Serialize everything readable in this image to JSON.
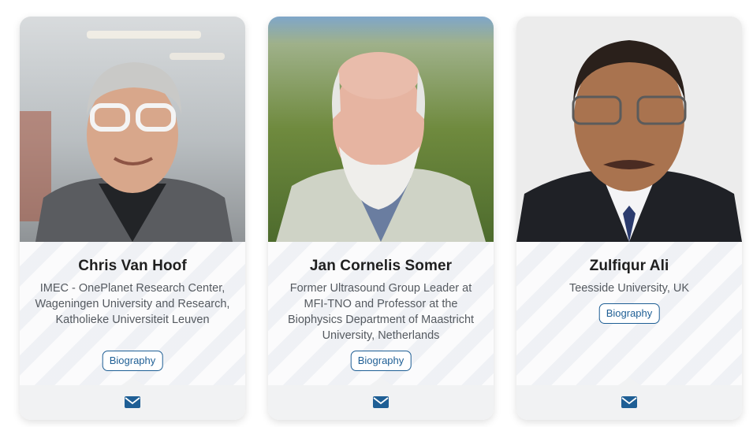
{
  "people": [
    {
      "name": "Chris Van Hoof",
      "affiliation": "IMEC - OnePlanet Research Center, Wageningen University and Research, Katholieke Universiteit Leuven",
      "biography_label": "Biography",
      "photo_icon": "portrait-photo",
      "email_icon": "envelope-icon"
    },
    {
      "name": "Jan Cornelis Somer",
      "affiliation": "Former Ultrasound Group Leader at MFI-TNO and Professor at the Biophysics Department of Maastricht University, Netherlands",
      "biography_label": "Biography",
      "photo_icon": "portrait-photo",
      "email_icon": "envelope-icon"
    },
    {
      "name": "Zulfiqur Ali",
      "affiliation": "Teesside University, UK",
      "biography_label": "Biography",
      "photo_icon": "portrait-photo",
      "email_icon": "envelope-icon"
    }
  ],
  "colors": {
    "accent": "#1f5f95",
    "name_text": "#1f1f1f",
    "affiliation_text": "#555a60",
    "footer_bg": "#f1f2f3"
  }
}
